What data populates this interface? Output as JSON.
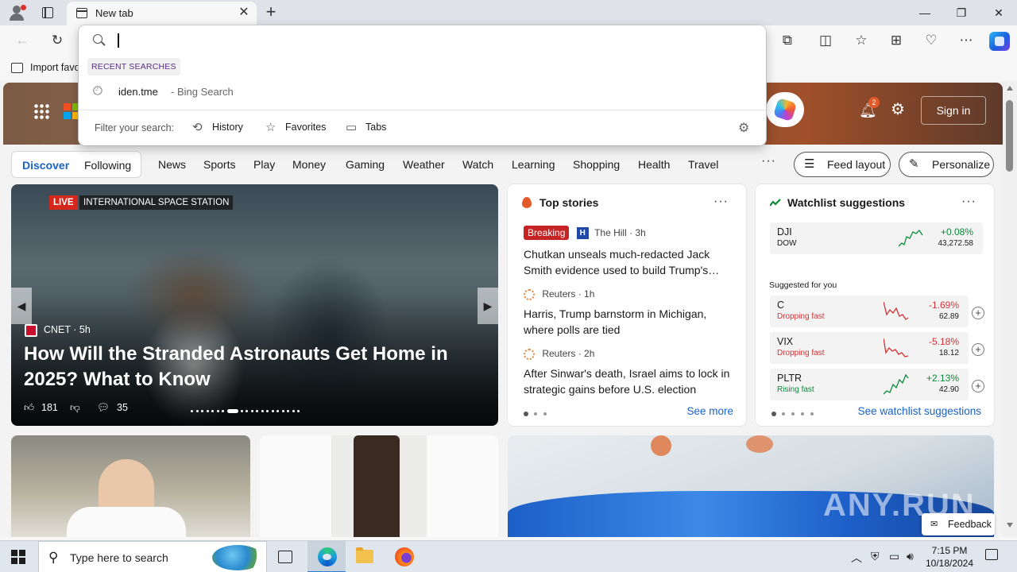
{
  "browser": {
    "tab_title": "New tab",
    "tab_close": "✕",
    "new_tab": "+",
    "minimize": "—",
    "maximize": "❐",
    "close": "✕",
    "favorites_bar_label": "Import favo",
    "toolbar_icons": [
      "back-icon",
      "refresh-icon",
      "extensions-icon",
      "split-screen-icon",
      "favorites-icon",
      "collections-icon",
      "browser-essentials-icon",
      "more-icon",
      "copilot-icon"
    ]
  },
  "address_dropdown": {
    "input_value": "",
    "recent_label": "RECENT SEARCHES",
    "items": [
      {
        "query": "iden.tme",
        "source": "- Bing Search"
      }
    ],
    "filter_label": "Filter your search:",
    "filters": [
      {
        "label": "History",
        "icon": "history-icon"
      },
      {
        "label": "Favorites",
        "icon": "star-icon"
      },
      {
        "label": "Tabs",
        "icon": "tabs-icon"
      }
    ]
  },
  "msn": {
    "banner": {
      "notification_count": "2",
      "sign_in": "Sign in"
    },
    "nav": {
      "segmented": [
        "Discover",
        "Following"
      ],
      "items": [
        "News",
        "Sports",
        "Play",
        "Money",
        "Gaming",
        "Weather",
        "Watch",
        "Learning",
        "Shopping",
        "Health",
        "Travel"
      ],
      "more": "···",
      "feed_layout": "Feed layout",
      "personalize": "Personalize"
    },
    "hero": {
      "live_label": "LIVE",
      "live_title": "INTERNATIONAL SPACE STATION",
      "source": "CNET · 5h",
      "title": "How Will the Stranded Astronauts Get Home in 2025? What to Know",
      "likes": "181",
      "comments": "35",
      "carousel_count": 20,
      "carousel_active": 7
    },
    "top_stories": {
      "title": "Top stories",
      "more": "···",
      "stories": [
        {
          "badge": "Breaking",
          "publisher": "The Hill · 3h",
          "pub_icon": "H",
          "title": "Chutkan unseals much-redacted Jack Smith evidence used to build Trump's…"
        },
        {
          "publisher": "Reuters · 1h",
          "title": "Harris, Trump barnstorm in Michigan, where polls are tied"
        },
        {
          "publisher": "Reuters · 2h",
          "title": "After Sinwar's death, Israel aims to lock in strategic gains before U.S. election"
        }
      ],
      "see_more": "See more"
    },
    "watchlist": {
      "title": "Watchlist suggestions",
      "more": "···",
      "main": {
        "symbol": "DJI",
        "name": "DOW",
        "change": "+0.08%",
        "price": "43,272.58"
      },
      "suggested_label": "Suggested for you",
      "suggestions": [
        {
          "symbol": "C",
          "status": "Dropping fast",
          "change": "-1.69%",
          "price": "62.89",
          "direction": "down"
        },
        {
          "symbol": "VIX",
          "status": "Dropping fast",
          "change": "-5.18%",
          "price": "18.12",
          "direction": "down"
        },
        {
          "symbol": "PLTR",
          "status": "Rising fast",
          "change": "+2.13%",
          "price": "42.90",
          "direction": "up"
        }
      ],
      "link": "See watchlist suggestions"
    },
    "feedback": "Feedback",
    "watermark": "ANY.RUN",
    "colors": {
      "accent": "#1862c9",
      "up": "#0b8a3a",
      "down": "#d13438"
    }
  },
  "taskbar": {
    "search_placeholder": "Type here to search",
    "time": "7:15 PM",
    "date": "10/18/2024"
  }
}
